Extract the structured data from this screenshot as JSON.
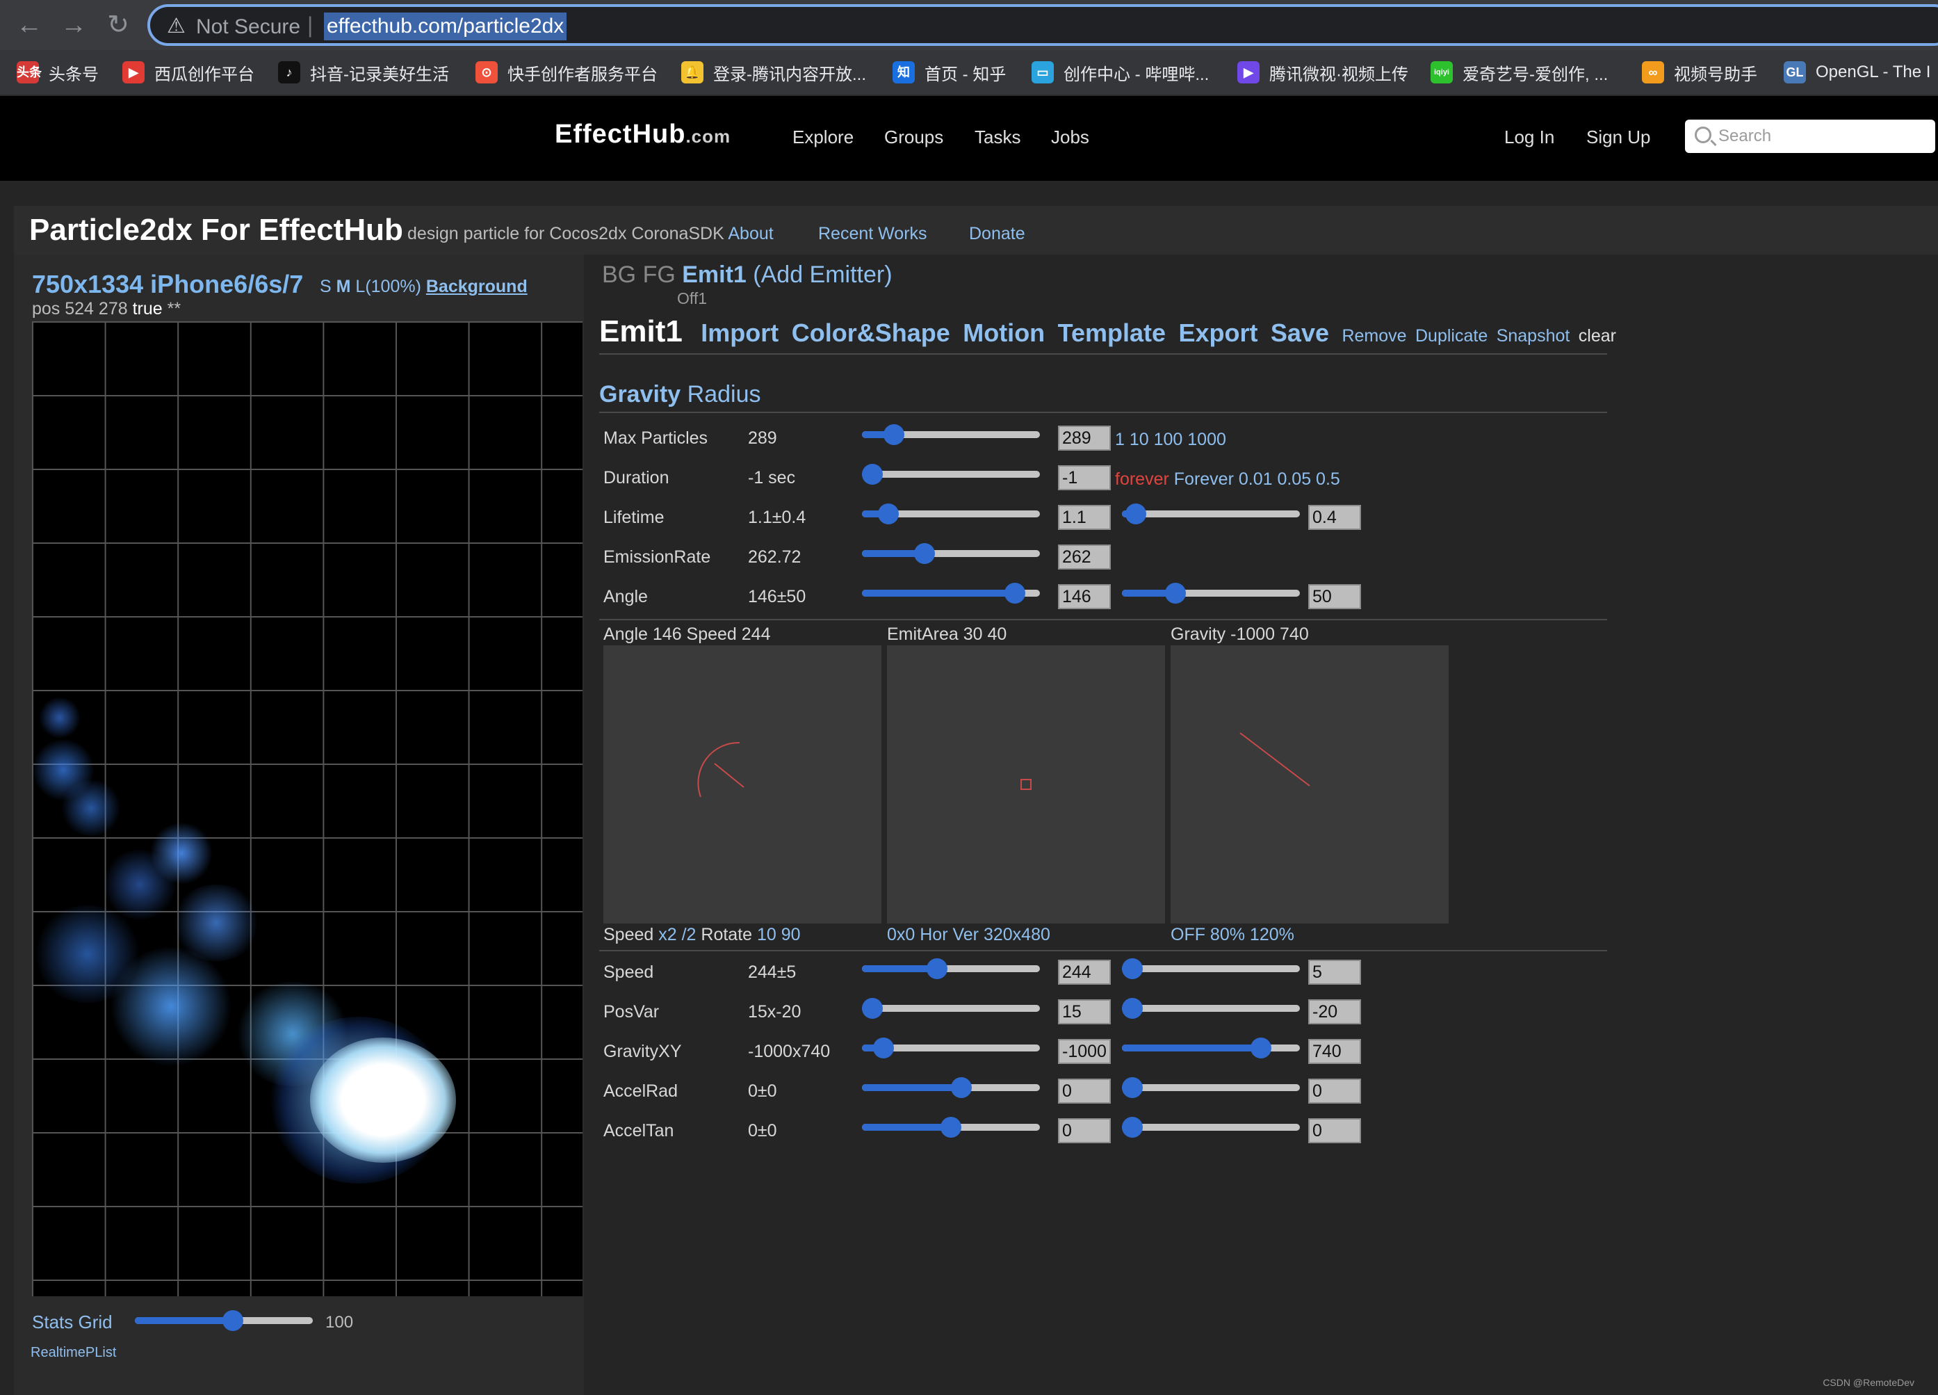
{
  "browser": {
    "security_label": "Not Secure",
    "url": "effecthub.com/particle2dx",
    "bookmarks": [
      {
        "label": "头条号",
        "icon": "toutiao-icon",
        "color": "#d53a36",
        "glyph": "头条"
      },
      {
        "label": "西瓜创作平台",
        "icon": "xigua-icon",
        "color": "#e13b33",
        "glyph": "▶"
      },
      {
        "label": "抖音-记录美好生活",
        "icon": "douyin-icon",
        "color": "#111111",
        "glyph": "♪"
      },
      {
        "label": "快手创作者服务平台",
        "icon": "kuaishou-icon",
        "color": "#f0513b",
        "glyph": "⊙"
      },
      {
        "label": "登录-腾讯内容开放...",
        "icon": "tencent-bell-icon",
        "color": "#f2c230",
        "glyph": "🔔"
      },
      {
        "label": "首页 - 知乎",
        "icon": "zhihu-icon",
        "color": "#1a6fe0",
        "glyph": "知"
      },
      {
        "label": "创作中心 - 哔哩哔...",
        "icon": "bilibili-icon",
        "color": "#2aa3de",
        "glyph": "▭"
      },
      {
        "label": "腾讯微视·视频上传",
        "icon": "weishi-icon",
        "color": "#7048e8",
        "glyph": "▶"
      },
      {
        "label": "爱奇艺号-爱创作, ...",
        "icon": "iqiyi-icon",
        "color": "#2ec12e",
        "glyph": "iqiyi"
      },
      {
        "label": "视频号助手",
        "icon": "channels-icon",
        "color": "#f29b1d",
        "glyph": "∞"
      },
      {
        "label": "OpenGL - The I",
        "icon": "opengl-icon",
        "color": "#4a79b8",
        "glyph": "GL"
      }
    ]
  },
  "site": {
    "logo_main": "EffectHub",
    "logo_domain": ".com",
    "nav": [
      "Explore",
      "Groups",
      "Tasks",
      "Jobs"
    ],
    "login": "Log In",
    "signup": "Sign Up",
    "search_placeholder": "Search"
  },
  "page": {
    "title": "Particle2dx For EffectHub",
    "subtitle": "design particle for Cocos2dx CoronaSDK",
    "about": "About",
    "recent_works": "Recent Works",
    "donate": "Donate"
  },
  "preview": {
    "device": "750x1334 iPhone6/6s/7",
    "size_s": "S",
    "size_m": "M",
    "size_l": "L(100%)",
    "background": "Background",
    "pos_label": "pos 524 278",
    "pos_flag": "true",
    "pos_suffix": "**",
    "stats_grid_label": "Stats Grid",
    "stats_grid_value": "100",
    "stats_grid_fraction": 0.55,
    "realtime": "RealtimePList"
  },
  "emitters": {
    "bg": "BG",
    "fg": "FG",
    "current": "Emit1",
    "add": "(Add Emitter)",
    "off": "Off1"
  },
  "menu": {
    "emit": "Emit1",
    "import": "Import",
    "color_shape": "Color&Shape",
    "motion": "Motion",
    "template": "Template",
    "export": "Export",
    "save": "Save",
    "remove": "Remove",
    "duplicate": "Duplicate",
    "snapshot": "Snapshot",
    "clear": "clear"
  },
  "mode": {
    "gravity": "Gravity",
    "radius": "Radius"
  },
  "params_top": [
    {
      "label": "Max Particles",
      "value": "289",
      "box": "289",
      "slider": 0.18,
      "presets": "1 10 100 1000"
    },
    {
      "label": "Duration",
      "value": "-1 sec",
      "box": "-1",
      "slider": 0.0,
      "preset_red": "forever",
      "presets": "Forever 0.01 0.05 0.5"
    },
    {
      "label": "Lifetime",
      "value": "1.1±0.4",
      "box": "1.1",
      "slider": 0.15,
      "var_box": "0.4",
      "var_slider": 0.08
    },
    {
      "label": "EmissionRate",
      "value": "262.72",
      "box": "262",
      "slider": 0.35
    },
    {
      "label": "Angle",
      "value": "146±50",
      "box": "146",
      "slider": 0.86,
      "var_box": "50",
      "var_slider": 0.3
    }
  ],
  "boxes": [
    {
      "title": "Angle 146 Speed 244",
      "sub_plain": "Speed ",
      "sub_link": "x2 /2",
      "sub_plain2": "  Rotate ",
      "sub_link2": "10 90"
    },
    {
      "title": "EmitArea 30 40",
      "sub_link": "0x0 Hor Ver 320x480"
    },
    {
      "title": "Gravity -1000 740",
      "sub_link": "OFF 80% 120%"
    }
  ],
  "params_bottom": [
    {
      "label": "Speed",
      "value": "244±5",
      "box": "244",
      "slider": 0.42,
      "var_box": "5",
      "var_slider": 0.06
    },
    {
      "label": "PosVar",
      "value": "15x-20",
      "box": "15",
      "slider": 0.06,
      "var_box": "-20",
      "var_slider": 0.06
    },
    {
      "label": "GravityXY",
      "value": "-1000x740",
      "box": "-1000",
      "slider": 0.12,
      "var_box": "740",
      "var_slider": 0.78
    },
    {
      "label": "AccelRad",
      "value": "0±0",
      "box": "0",
      "slider": 0.56,
      "var_box": "0",
      "var_slider": 0.06
    },
    {
      "label": "AccelTan",
      "value": "0±0",
      "box": "0",
      "slider": 0.5,
      "var_box": "0",
      "var_slider": 0.06
    }
  ],
  "watermark": "CSDN @RemoteDev"
}
